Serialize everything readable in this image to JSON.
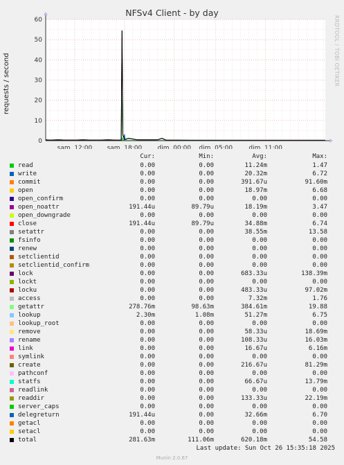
{
  "chart_data": {
    "type": "line",
    "title": "NFSv4 Client - by day",
    "ylabel": "requests / second",
    "ylim": [
      0,
      60
    ],
    "yticks": [
      0,
      10,
      20,
      30,
      40,
      50,
      60
    ],
    "xticks": [
      "sam. 12:00",
      "sam. 18:00",
      "dim. 00:00",
      "dim. 05:00",
      "dim. 11:00"
    ],
    "xtick_hours": [
      12,
      18,
      24,
      29,
      35
    ],
    "xlim_hours": [
      8.5,
      42.2
    ],
    "grid": true,
    "series": [
      {
        "name": "total",
        "color": "#000000",
        "points": [
          [
            8.5,
            0.4
          ],
          [
            9,
            0.3
          ],
          [
            10,
            0.4
          ],
          [
            11,
            0.3
          ],
          [
            12,
            0.3
          ],
          [
            13,
            0.4
          ],
          [
            14,
            0.3
          ],
          [
            15,
            0.3
          ],
          [
            16,
            0.4
          ],
          [
            17,
            0.3
          ],
          [
            17.6,
            0.3
          ],
          [
            17.7,
            54.5
          ],
          [
            17.8,
            3.0
          ],
          [
            18.0,
            0.5
          ],
          [
            18.5,
            1.2
          ],
          [
            19.5,
            0.4
          ],
          [
            21,
            0.4
          ],
          [
            22,
            0.4
          ],
          [
            22.5,
            1.2
          ],
          [
            23,
            0.3
          ],
          [
            26,
            0.2
          ],
          [
            30,
            0.2
          ],
          [
            34,
            0.2
          ],
          [
            38,
            0.2
          ],
          [
            42.2,
            0.2
          ]
        ]
      },
      {
        "name": "getattr",
        "color": "#7de28c",
        "points": [
          [
            8.5,
            0.2
          ],
          [
            17.6,
            0.2
          ],
          [
            17.7,
            19.88
          ],
          [
            17.8,
            1.0
          ],
          [
            18.0,
            0.3
          ],
          [
            42.2,
            0.1
          ]
        ]
      },
      {
        "name": "read",
        "color": "#00cc00",
        "points": [
          [
            8.5,
            0.0
          ],
          [
            17.65,
            0.0
          ],
          [
            17.72,
            1.47
          ],
          [
            17.8,
            0.0
          ],
          [
            42.2,
            0.0
          ]
        ]
      },
      {
        "name": "write",
        "color": "#0066b3",
        "points": [
          [
            8.5,
            0.0
          ],
          [
            17.9,
            0.0
          ],
          [
            18.0,
            3.2
          ],
          [
            18.1,
            0.0
          ],
          [
            42.2,
            0.0
          ]
        ]
      }
    ]
  },
  "legend": {
    "headers": {
      "cur": "Cur:",
      "min": "Min:",
      "avg": "Avg:",
      "max": "Max:"
    },
    "rows": [
      {
        "name": "read",
        "color": "#00cc00",
        "cur": "0.00",
        "min": "0.00",
        "avg": "11.24m",
        "max": "1.47"
      },
      {
        "name": "write",
        "color": "#0066b3",
        "cur": "0.00",
        "min": "0.00",
        "avg": "20.32m",
        "max": "6.72"
      },
      {
        "name": "commit",
        "color": "#ff8000",
        "cur": "0.00",
        "min": "0.00",
        "avg": "391.67u",
        "max": "91.60m"
      },
      {
        "name": "open",
        "color": "#ffcc00",
        "cur": "0.00",
        "min": "0.00",
        "avg": "18.97m",
        "max": "6.68"
      },
      {
        "name": "open_confirm",
        "color": "#330099",
        "cur": "0.00",
        "min": "0.00",
        "avg": "0.00",
        "max": "0.00"
      },
      {
        "name": "open_noattr",
        "color": "#990099",
        "cur": "191.44u",
        "min": "89.79u",
        "avg": "18.19m",
        "max": "3.47"
      },
      {
        "name": "open_downgrade",
        "color": "#ccff00",
        "cur": "0.00",
        "min": "0.00",
        "avg": "0.00",
        "max": "0.00"
      },
      {
        "name": "close",
        "color": "#ff0000",
        "cur": "191.44u",
        "min": "89.79u",
        "avg": "34.88m",
        "max": "6.74"
      },
      {
        "name": "setattr",
        "color": "#808080",
        "cur": "0.00",
        "min": "0.00",
        "avg": "38.55m",
        "max": "13.58"
      },
      {
        "name": "fsinfo",
        "color": "#008f00",
        "cur": "0.00",
        "min": "0.00",
        "avg": "0.00",
        "max": "0.00"
      },
      {
        "name": "renew",
        "color": "#00487d",
        "cur": "0.00",
        "min": "0.00",
        "avg": "0.00",
        "max": "0.00"
      },
      {
        "name": "setclientid",
        "color": "#b35a00",
        "cur": "0.00",
        "min": "0.00",
        "avg": "0.00",
        "max": "0.00"
      },
      {
        "name": "setclientid_confirm",
        "color": "#b38f00",
        "cur": "0.00",
        "min": "0.00",
        "avg": "0.00",
        "max": "0.00"
      },
      {
        "name": "lock",
        "color": "#6b006b",
        "cur": "0.00",
        "min": "0.00",
        "avg": "683.33u",
        "max": "138.39m"
      },
      {
        "name": "lockt",
        "color": "#8fb300",
        "cur": "0.00",
        "min": "0.00",
        "avg": "0.00",
        "max": "0.00"
      },
      {
        "name": "locku",
        "color": "#b30000",
        "cur": "0.00",
        "min": "0.00",
        "avg": "483.33u",
        "max": "97.02m"
      },
      {
        "name": "access",
        "color": "#bebebe",
        "cur": "0.00",
        "min": "0.00",
        "avg": "7.32m",
        "max": "1.76"
      },
      {
        "name": "getattr",
        "color": "#80ff80",
        "cur": "278.76m",
        "min": "98.63m",
        "avg": "384.61m",
        "max": "19.88"
      },
      {
        "name": "lookup",
        "color": "#80c9ff",
        "cur": "2.30m",
        "min": "1.08m",
        "avg": "51.27m",
        "max": "6.75"
      },
      {
        "name": "lookup_root",
        "color": "#ffc080",
        "cur": "0.00",
        "min": "0.00",
        "avg": "0.00",
        "max": "0.00"
      },
      {
        "name": "remove",
        "color": "#ffe680",
        "cur": "0.00",
        "min": "0.00",
        "avg": "58.33u",
        "max": "18.69m"
      },
      {
        "name": "rename",
        "color": "#aa80ff",
        "cur": "0.00",
        "min": "0.00",
        "avg": "108.33u",
        "max": "16.03m"
      },
      {
        "name": "link",
        "color": "#ee00cc",
        "cur": "0.00",
        "min": "0.00",
        "avg": "16.67u",
        "max": "6.16m"
      },
      {
        "name": "symlink",
        "color": "#ff8080",
        "cur": "0.00",
        "min": "0.00",
        "avg": "0.00",
        "max": "0.00"
      },
      {
        "name": "create",
        "color": "#666600",
        "cur": "0.00",
        "min": "0.00",
        "avg": "216.67u",
        "max": "81.29m"
      },
      {
        "name": "pathconf",
        "color": "#ffbfff",
        "cur": "0.00",
        "min": "0.00",
        "avg": "0.00",
        "max": "0.00"
      },
      {
        "name": "statfs",
        "color": "#00ffcc",
        "cur": "0.00",
        "min": "0.00",
        "avg": "66.67u",
        "max": "13.79m"
      },
      {
        "name": "readlink",
        "color": "#cc6699",
        "cur": "0.00",
        "min": "0.00",
        "avg": "0.00",
        "max": "0.00"
      },
      {
        "name": "readdir",
        "color": "#999900",
        "cur": "0.00",
        "min": "0.00",
        "avg": "133.33u",
        "max": "22.19m"
      },
      {
        "name": "server_caps",
        "color": "#00cc00",
        "cur": "0.00",
        "min": "0.00",
        "avg": "0.00",
        "max": "0.00"
      },
      {
        "name": "delegreturn",
        "color": "#0066b3",
        "cur": "191.44u",
        "min": "0.00",
        "avg": "32.66m",
        "max": "6.70"
      },
      {
        "name": "getacl",
        "color": "#ff8000",
        "cur": "0.00",
        "min": "0.00",
        "avg": "0.00",
        "max": "0.00"
      },
      {
        "name": "setacl",
        "color": "#ffcc00",
        "cur": "0.00",
        "min": "0.00",
        "avg": "0.00",
        "max": "0.00"
      },
      {
        "name": "total",
        "color": "#000000",
        "cur": "281.63m",
        "min": "111.06m",
        "avg": "620.18m",
        "max": "54.58"
      }
    ]
  },
  "footer": {
    "last_update": "Last update: Sun Oct 26 15:35:18 2025",
    "version": "Munin 2.0.67",
    "side_text": "RRDTOOL / TOBI OETIKER"
  }
}
